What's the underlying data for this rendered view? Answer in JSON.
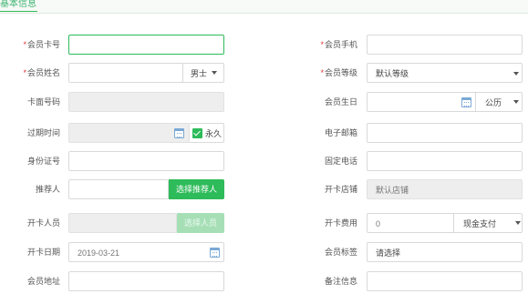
{
  "header": {
    "title": "基本信息"
  },
  "fields": {
    "card_no": {
      "label": "会员卡号",
      "value": ""
    },
    "name": {
      "label": "会员姓名",
      "value": "",
      "gender": "男士"
    },
    "card_code": {
      "label": "卡面号码",
      "value": ""
    },
    "expire": {
      "label": "过期时间",
      "value": "",
      "permanent_label": "永久",
      "permanent": true
    },
    "id_no": {
      "label": "身份证号",
      "value": ""
    },
    "referrer": {
      "label": "推荐人",
      "value": "",
      "button": "选择推荐人"
    },
    "operator": {
      "label": "开卡人员",
      "value": "",
      "button": "选择人员"
    },
    "open_date": {
      "label": "开卡日期",
      "value": "2019-03-21"
    },
    "address": {
      "label": "会员地址",
      "value": ""
    },
    "phone": {
      "label": "会员手机",
      "value": ""
    },
    "level": {
      "label": "会员等级",
      "value": "默认等级"
    },
    "birthday": {
      "label": "会员生日",
      "value": "",
      "calendar": "公历"
    },
    "email": {
      "label": "电子邮箱",
      "value": ""
    },
    "tel": {
      "label": "固定电话",
      "value": ""
    },
    "store": {
      "label": "开卡店铺",
      "value": "默认店铺"
    },
    "fee": {
      "label": "开卡费用",
      "value": "0",
      "payment": "现金支付"
    },
    "tag": {
      "label": "会员标签",
      "value": "请选择"
    },
    "remark": {
      "label": "备注信息",
      "value": ""
    }
  },
  "required_mark": "*",
  "colors": {
    "accent": "#2ebb5a",
    "required": "#e03434",
    "disabled_bg": "#eeeeee"
  }
}
